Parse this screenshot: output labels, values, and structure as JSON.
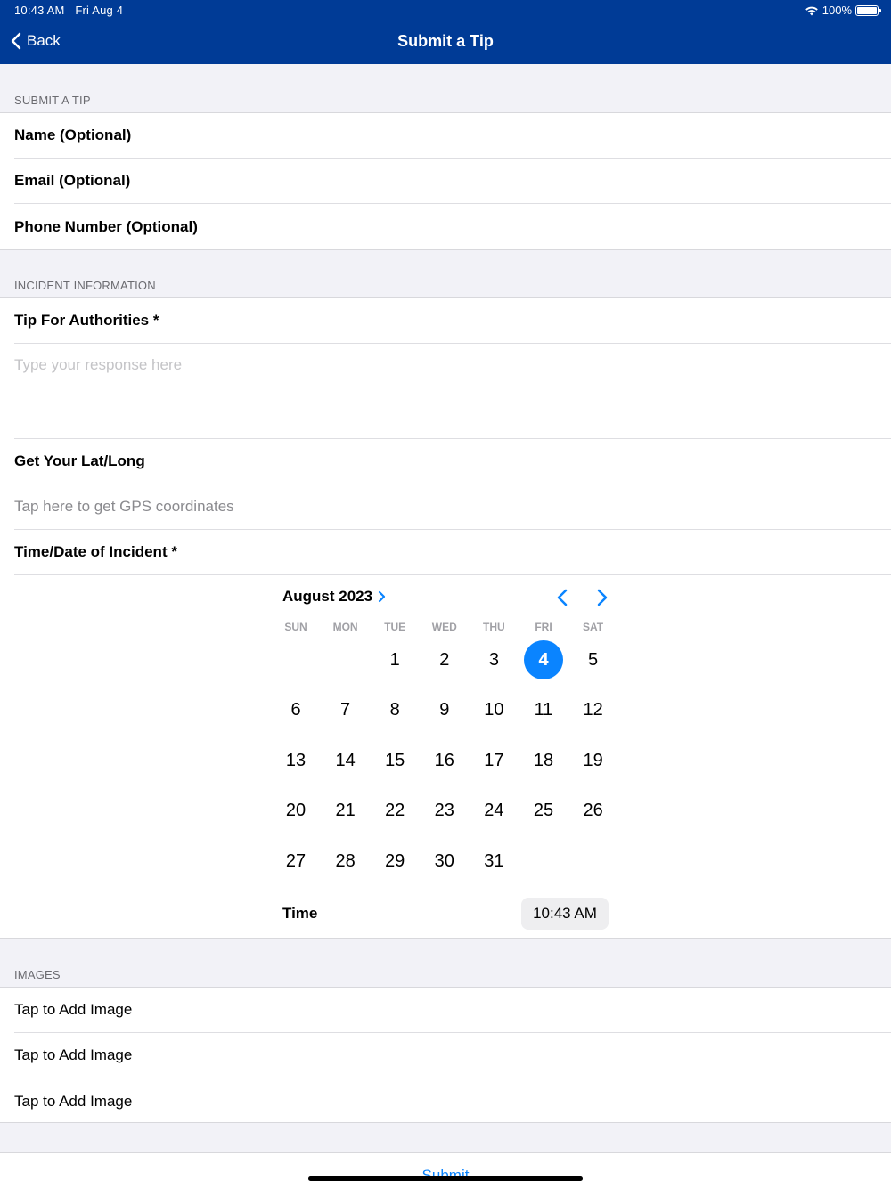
{
  "status_bar": {
    "time": "10:43 AM",
    "date": "Fri Aug 4",
    "battery": "100%"
  },
  "nav": {
    "back_label": "Back",
    "title": "Submit a Tip"
  },
  "sections": {
    "tip": {
      "header": "SUBMIT A TIP",
      "fields": [
        "Name (Optional)",
        "Email (Optional)",
        "Phone Number (Optional)"
      ]
    },
    "incident": {
      "header": "INCIDENT INFORMATION",
      "tip_label": "Tip For Authorities *",
      "tip_placeholder": "Type your response here",
      "latlong_label": "Get Your Lat/Long",
      "gps_hint": "Tap here to get GPS coordinates",
      "datetime_label": "Time/Date of Incident *"
    },
    "images": {
      "header": "IMAGES",
      "items": [
        "Tap to Add Image",
        "Tap to Add Image",
        "Tap to Add Image"
      ]
    }
  },
  "calendar": {
    "month_label": "August 2023",
    "weekdays": [
      "SUN",
      "MON",
      "TUE",
      "WED",
      "THU",
      "FRI",
      "SAT"
    ],
    "first_weekday_index": 2,
    "days_in_month": 31,
    "selected_day": 4,
    "time_label": "Time",
    "time_value": "10:43 AM"
  },
  "submit_label": "Submit",
  "colors": {
    "nav_bg": "#003b96",
    "accent": "#0a84ff",
    "page_bg": "#f2f2f7"
  }
}
